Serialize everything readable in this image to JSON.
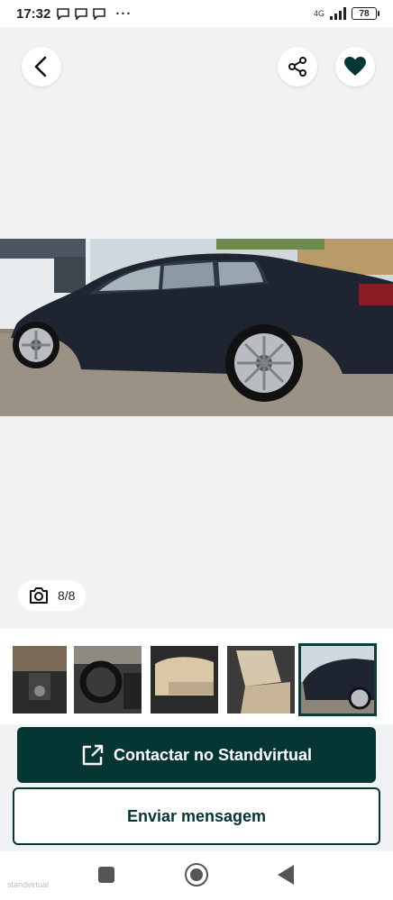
{
  "status_bar": {
    "time": "17:32",
    "more": "···",
    "network": "4G",
    "battery": "78"
  },
  "gallery": {
    "counter": "8/8",
    "icons": [
      "chevron-left-icon",
      "share-icon",
      "heart-icon",
      "camera-icon"
    ],
    "colors": {
      "button_bg": "#ffffff",
      "favorite": "#053633"
    }
  },
  "thumbnails": {
    "count": 5,
    "selected_index": 4,
    "descriptions": [
      "center-console",
      "steering-wheel",
      "front-seat",
      "rear-seat",
      "car-side"
    ]
  },
  "actions": {
    "contact_label": "Contactar no Standvirtual",
    "message_label": "Enviar mensagem",
    "brand_color": "#053633"
  },
  "nav": {
    "watermark": "standvirtual"
  }
}
